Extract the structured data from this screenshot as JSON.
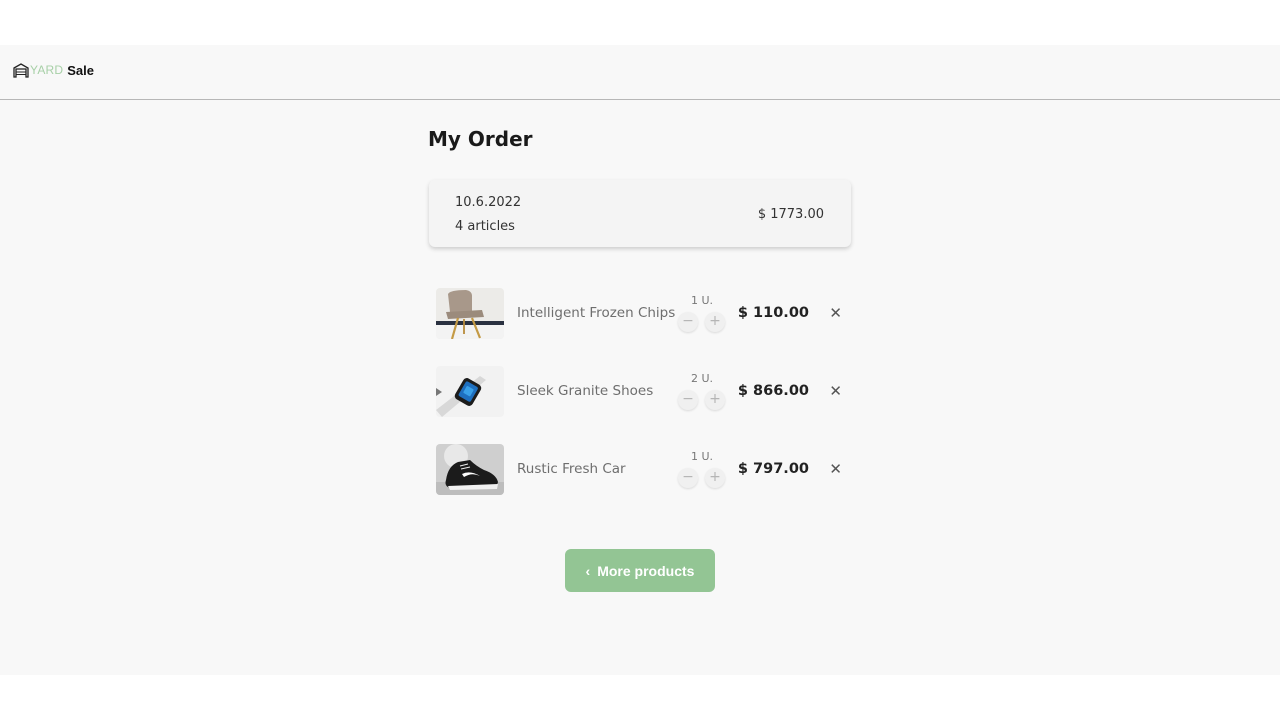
{
  "brand": {
    "logo_part1": "YARD",
    "logo_part2": "Sale",
    "accent_color": "#93c594"
  },
  "page": {
    "title": "My Order"
  },
  "order": {
    "date": "10.6.2022",
    "articles": "4 articles",
    "total": "$ 1773.00"
  },
  "items": [
    {
      "name": "Intelligent Frozen Chips",
      "quantity": "1 U.",
      "price": "$ 110.00",
      "image": "chair"
    },
    {
      "name": "Sleek Granite Shoes",
      "quantity": "2 U.",
      "price": "$ 866.00",
      "image": "smartwatch"
    },
    {
      "name": "Rustic Fresh Car",
      "quantity": "1 U.",
      "price": "$ 797.00",
      "image": "sneaker"
    }
  ],
  "controls": {
    "decrease_symbol": "−",
    "increase_symbol": "+",
    "remove_symbol": "✕"
  },
  "actions": {
    "more_products": "More products"
  },
  "icons": {
    "logo": "garage-icon",
    "back": "chevron-left-icon",
    "remove": "close-icon"
  }
}
